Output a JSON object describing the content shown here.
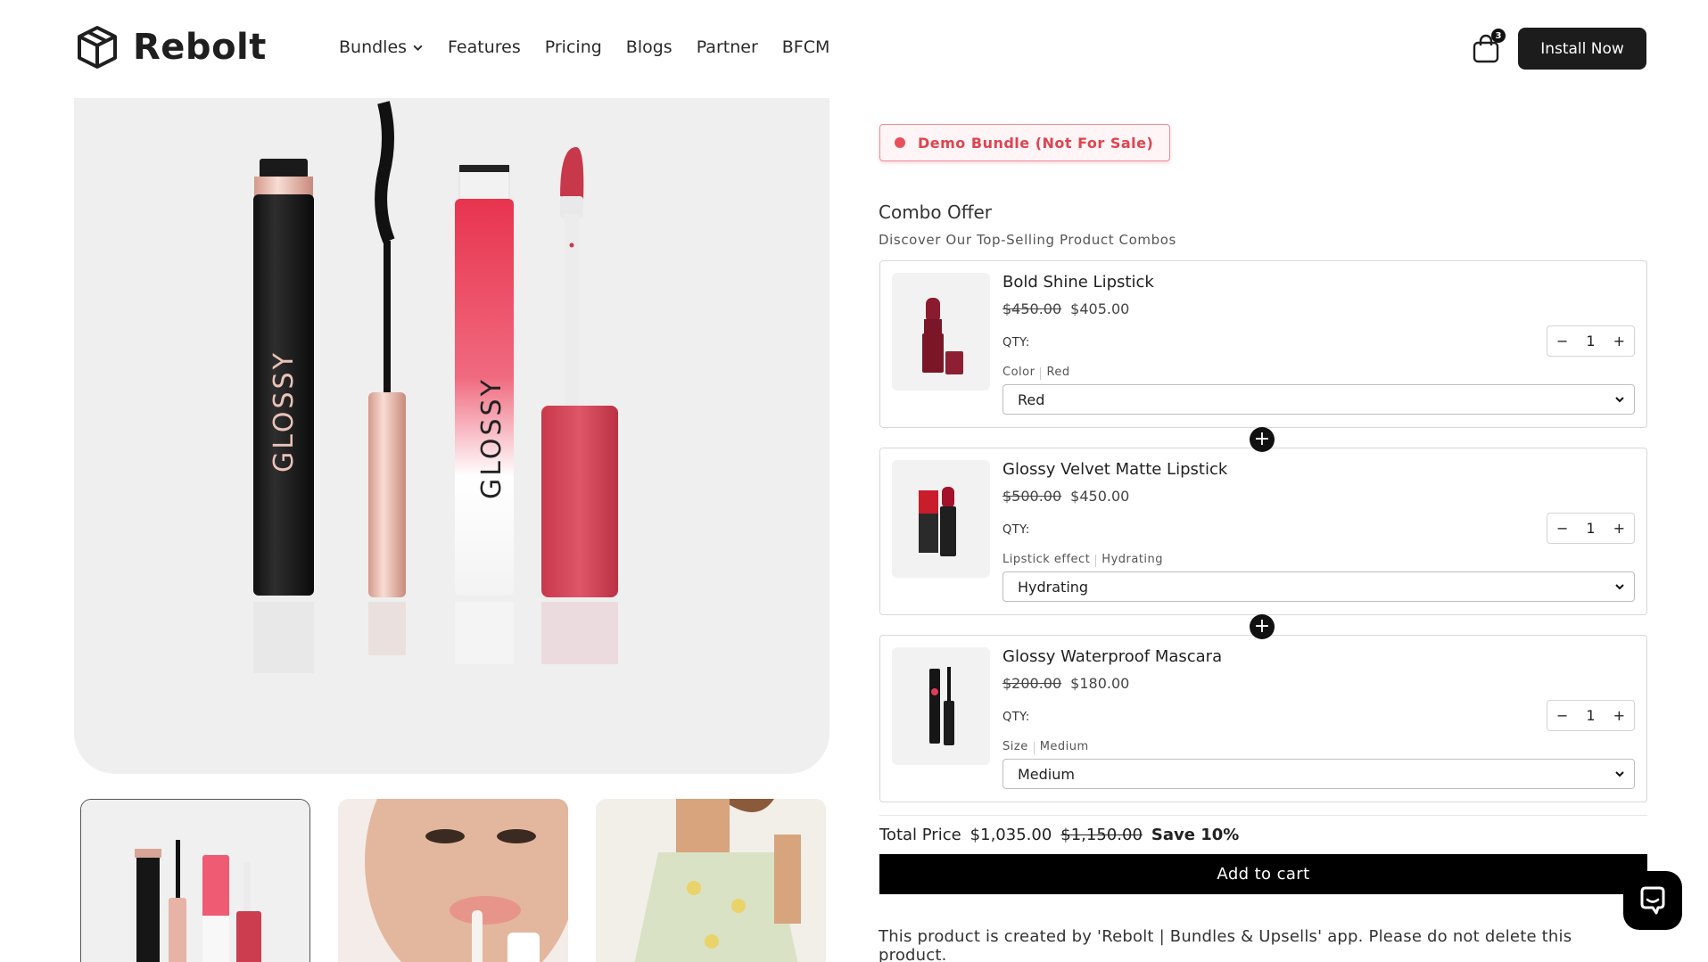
{
  "brand": {
    "name": "Rebolt"
  },
  "nav": {
    "items": [
      {
        "label": "Bundles",
        "has_dropdown": true
      },
      {
        "label": "Features"
      },
      {
        "label": "Pricing"
      },
      {
        "label": "Blogs"
      },
      {
        "label": "Partner"
      },
      {
        "label": "BFCM"
      }
    ]
  },
  "cart": {
    "count": "3"
  },
  "header": {
    "install_label": "Install Now"
  },
  "product": {
    "image_brand_text": "GLOSSY",
    "demo_badge": "Demo Bundle (Not For Sale)",
    "combo_title": "Combo Offer",
    "combo_subtitle": "Discover Our Top-Selling Product Combos",
    "items": [
      {
        "name": "Bold Shine Lipstick",
        "old_price": "$450.00",
        "price": "$405.00",
        "qty_label": "QTY:",
        "qty": "1",
        "option_name": "Color",
        "option_value": "Red",
        "select_value": "Red"
      },
      {
        "name": "Glossy Velvet Matte Lipstick",
        "old_price": "$500.00",
        "price": "$450.00",
        "qty_label": "QTY:",
        "qty": "1",
        "option_name": "Lipstick effect",
        "option_value": "Hydrating",
        "select_value": "Hydrating"
      },
      {
        "name": "Glossy Waterproof Mascara",
        "old_price": "$200.00",
        "price": "$180.00",
        "qty_label": "QTY:",
        "qty": "1",
        "option_name": "Size",
        "option_value": "Medium",
        "select_value": "Medium"
      }
    ],
    "total_label": "Total Price",
    "total_price": "$1,035.00",
    "total_old_price": "$1,150.00",
    "save_text": "Save 10%",
    "add_to_cart": "Add to cart",
    "footer_note": "This product is created by 'Rebolt | Bundles & Upsells' app. Please do not delete this product."
  },
  "colors": {
    "accent": "#e0434f",
    "button_dark": "#1c1c1c",
    "lipstick_red": "#c8384b",
    "image_bg": "#efefef"
  }
}
